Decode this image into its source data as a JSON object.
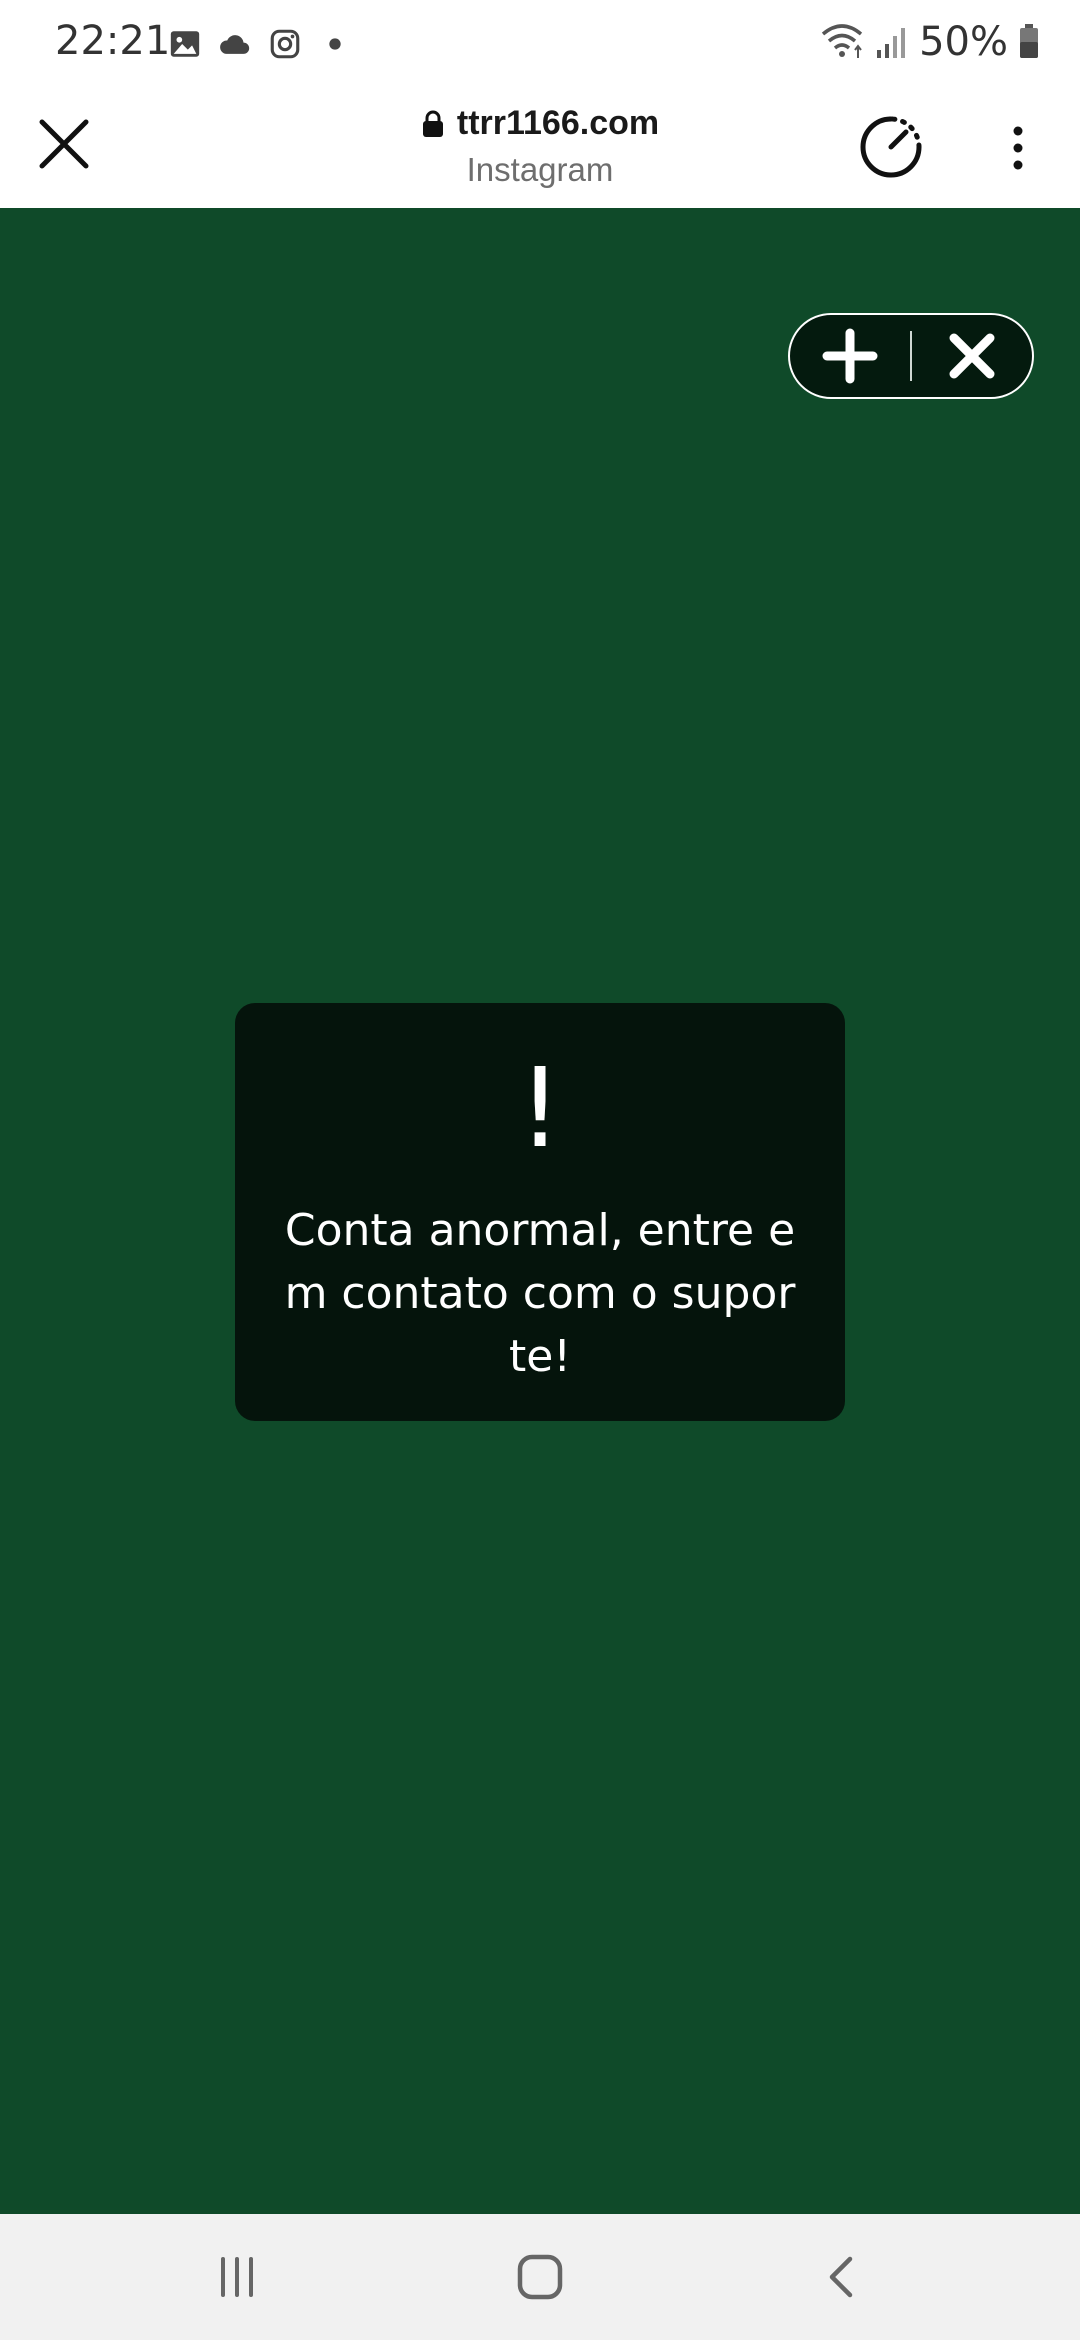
{
  "status_bar": {
    "time": "22:21",
    "battery": "50%",
    "left_icons": [
      "gallery-icon",
      "cloud-icon",
      "instagram-icon",
      "dot-icon"
    ],
    "right_icons": [
      "wifi-icon",
      "signal-icon",
      "battery-icon"
    ]
  },
  "browser": {
    "url": "ttrr1166.com",
    "site_name": "Instagram",
    "icons": [
      "close-icon",
      "lock-icon",
      "speed-icon",
      "more-vertical-icon"
    ]
  },
  "page": {
    "background_color": "#0f4a29",
    "pill_icons": [
      "plus-icon",
      "close-icon"
    ],
    "toast": {
      "icon": "!",
      "message": "Conta anormal, entre em contato com o suporte!"
    }
  },
  "nav_bar": {
    "icons": [
      "recent-apps-icon",
      "home-icon",
      "back-icon"
    ]
  }
}
